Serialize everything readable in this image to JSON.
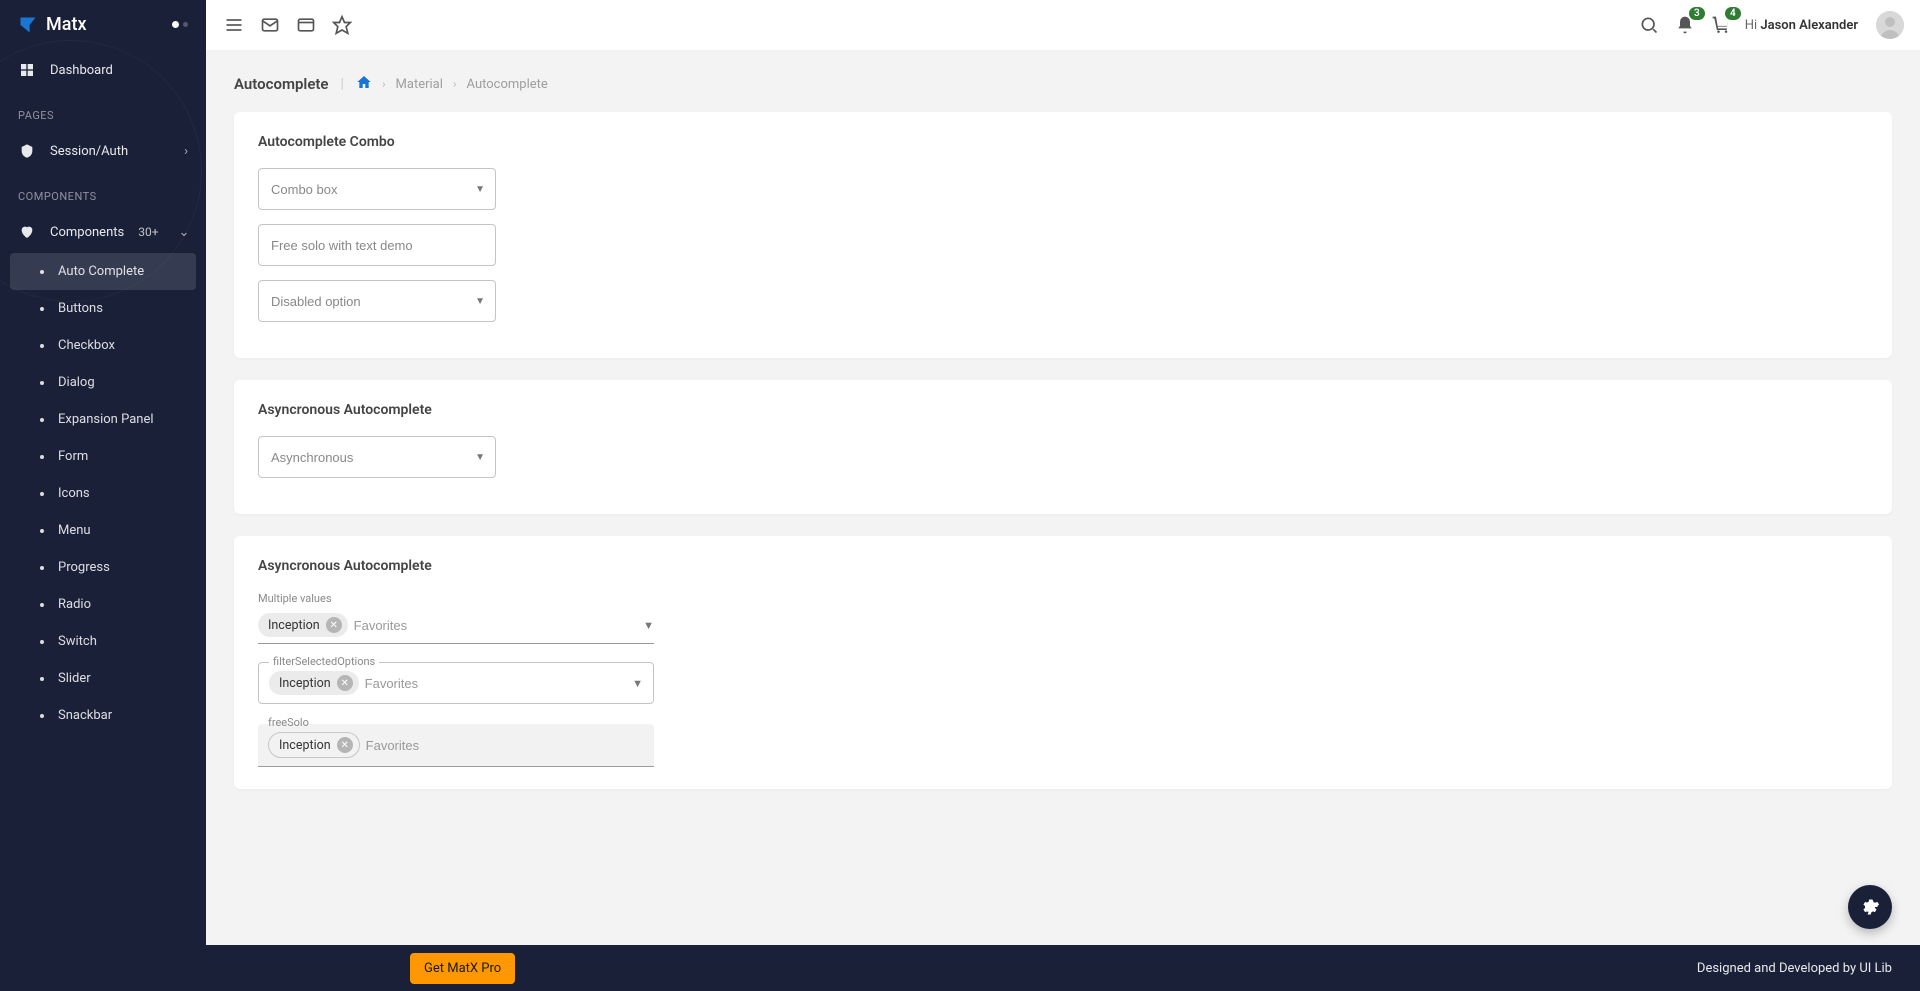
{
  "brand": {
    "name": "Matx"
  },
  "sidebar": {
    "dashboard": "Dashboard",
    "section_pages": "PAGES",
    "session_auth": "Session/Auth",
    "section_components": "COMPONENTS",
    "components": {
      "label": "Components",
      "count": "30+"
    },
    "subs": [
      "Auto Complete",
      "Buttons",
      "Checkbox",
      "Dialog",
      "Expansion Panel",
      "Form",
      "Icons",
      "Menu",
      "Progress",
      "Radio",
      "Switch",
      "Slider",
      "Snackbar"
    ]
  },
  "topbar": {
    "notif_badge": "3",
    "cart_badge": "4",
    "greet_prefix": "Hi",
    "user_name": "Jason Alexander"
  },
  "breadcrumb": {
    "title": "Autocomplete",
    "mid": "Material",
    "last": "Autocomplete"
  },
  "cards": {
    "c1": {
      "title": "Autocomplete Combo",
      "combo_placeholder": "Combo box",
      "freesolo_placeholder": "Free solo with text demo",
      "disabled_placeholder": "Disabled option"
    },
    "c2": {
      "title": "Asyncronous Autocomplete",
      "async_placeholder": "Asynchronous"
    },
    "c3": {
      "title": "Asyncronous Autocomplete",
      "multi_label": "Multiple values",
      "chip1": "Inception",
      "fav_placeholder": "Favorites",
      "filter_label": "filterSelectedOptions",
      "chip2": "Inception",
      "freesolo_label": "freeSolo",
      "chip3": "Inception"
    }
  },
  "footer": {
    "cta": "Get MatX Pro",
    "credit": "Designed and Developed by UI Lib"
  }
}
